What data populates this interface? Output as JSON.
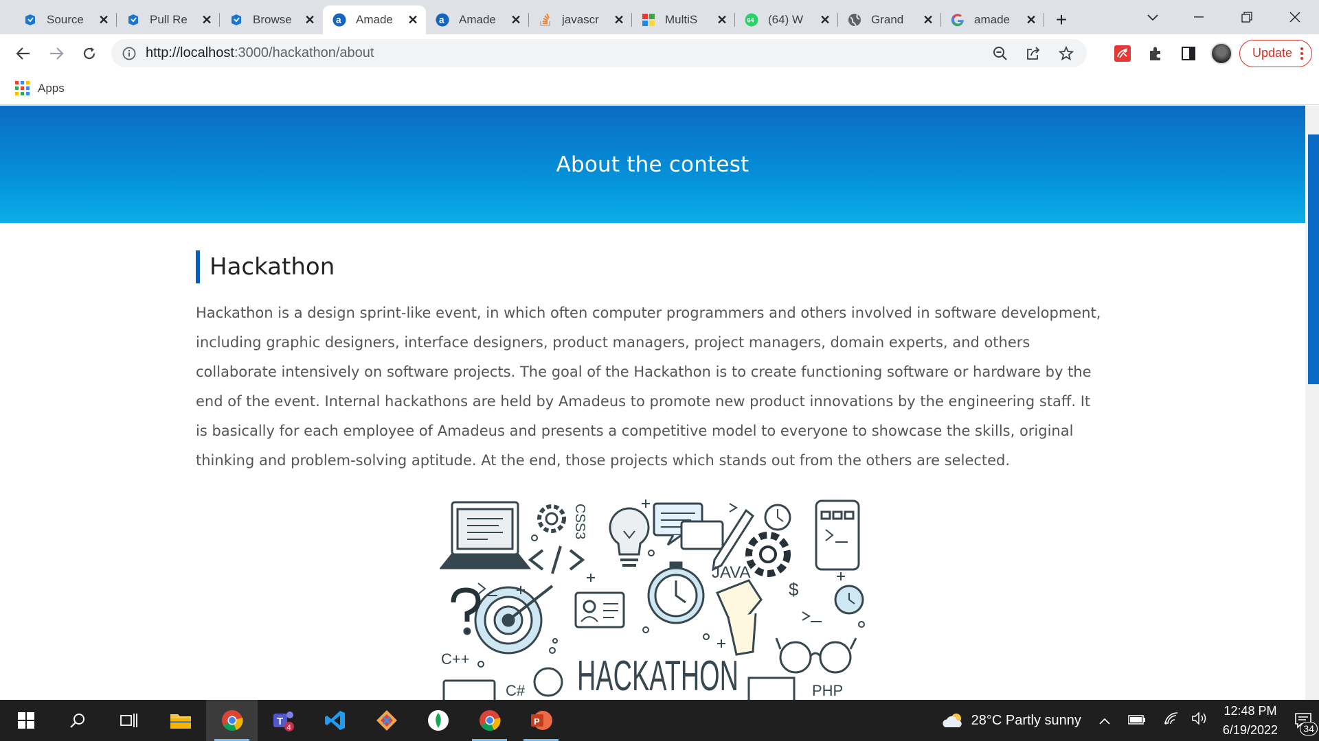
{
  "tabs": [
    {
      "label": "Source",
      "icon": "azure-devops-icon"
    },
    {
      "label": "Pull Re",
      "icon": "azure-devops-icon"
    },
    {
      "label": "Browse",
      "icon": "azure-devops-icon"
    },
    {
      "label": "Amade",
      "icon": "amadeus-icon",
      "active": true
    },
    {
      "label": "Amade",
      "icon": "amadeus-icon"
    },
    {
      "label": "javascr",
      "icon": "stackoverflow-icon"
    },
    {
      "label": "MultiS",
      "icon": "multi-site-icon"
    },
    {
      "label": "(64) W",
      "icon": "whatsapp-icon",
      "badge": "64"
    },
    {
      "label": "Grand",
      "icon": "globe-icon"
    },
    {
      "label": "amade",
      "icon": "google-icon"
    }
  ],
  "address_bar": {
    "url_host": "http://localhost",
    "url_path": ":3000/hackathon/about"
  },
  "toolbar": {
    "update_label": "Update"
  },
  "bookmarks": {
    "apps_label": "Apps"
  },
  "page": {
    "hero_title": "About the contest",
    "section_title": "Hackathon",
    "description": "Hackathon is a design sprint-like event, in which often computer programmers and others involved in software development, including graphic designers, interface designers, product managers, project managers, domain experts, and others collaborate intensively on software projects. The goal of the Hackathon is to create functioning software or hardware by the end of the event. Internal hackathons are held by Amadeus to promote new product innovations by the engineering staff. It is basically for each employee of Amadeus and presents a competitive model to everyone to showcase the skills, original thinking and problem-solving aptitude. At the end, those projects which stands out from the others are selected.",
    "illustration": {
      "title": "HACKATHON",
      "labels": [
        "JAVA",
        "C++",
        "C#",
        "PHP",
        "CSS3",
        "$",
        "?"
      ]
    }
  },
  "taskbar": {
    "weather": "28°C  Partly sunny",
    "time": "12:48 PM",
    "date": "6/19/2022",
    "notifications": "34",
    "teams_badge": "4"
  },
  "colors": {
    "accent": "#0b6bc4",
    "hero_bottom": "#0aaee8",
    "update_red": "#d93025"
  }
}
